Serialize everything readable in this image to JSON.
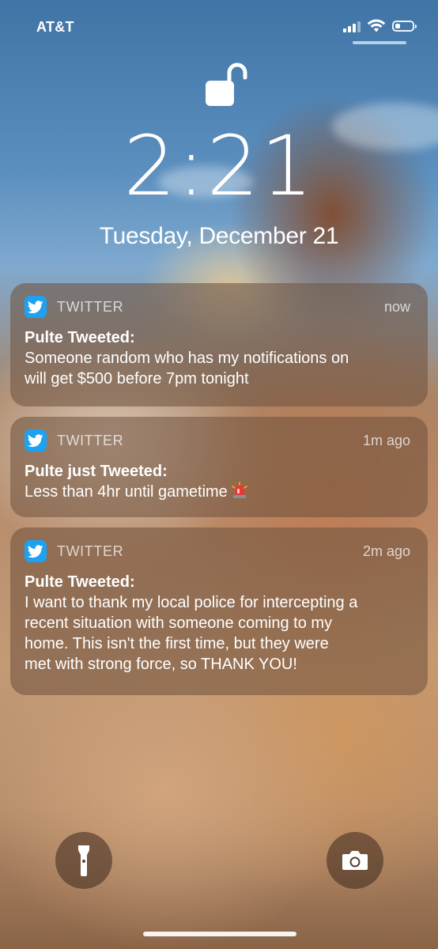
{
  "status_bar": {
    "carrier": "AT&T",
    "signal_bars_active": 3,
    "signal_bars_total": 4,
    "battery_level": 0.3,
    "icons": [
      "signal-icon",
      "wifi-icon",
      "battery-icon"
    ]
  },
  "lock_screen": {
    "lock_state": "unlocked",
    "time": "2:21",
    "date": "Tuesday, December 21"
  },
  "notifications": [
    {
      "app": "TWITTER",
      "time": "now",
      "title": "Pulte Tweeted:",
      "body": "Someone random who has my notifications on\nwill get $500 before 7pm tonight"
    },
    {
      "app": "TWITTER",
      "time": "1m ago",
      "title": "Pulte just Tweeted:",
      "body": "Less than 4hr until gametime",
      "emoji": "police-light-icon"
    },
    {
      "app": "TWITTER",
      "time": "2m ago",
      "title": "Pulte Tweeted:",
      "body": "I want to thank my local police for intercepting a\nrecent situation with someone coming to my\nhome.  This isn't the first time, but they were\nmet with strong force, so THANK YOU!"
    }
  ],
  "controls": {
    "left": "flashlight-icon",
    "right": "camera-icon"
  },
  "colors": {
    "twitter_blue": "#1da1f2",
    "notification_bg": "rgba(110,80,60,0.55)"
  }
}
